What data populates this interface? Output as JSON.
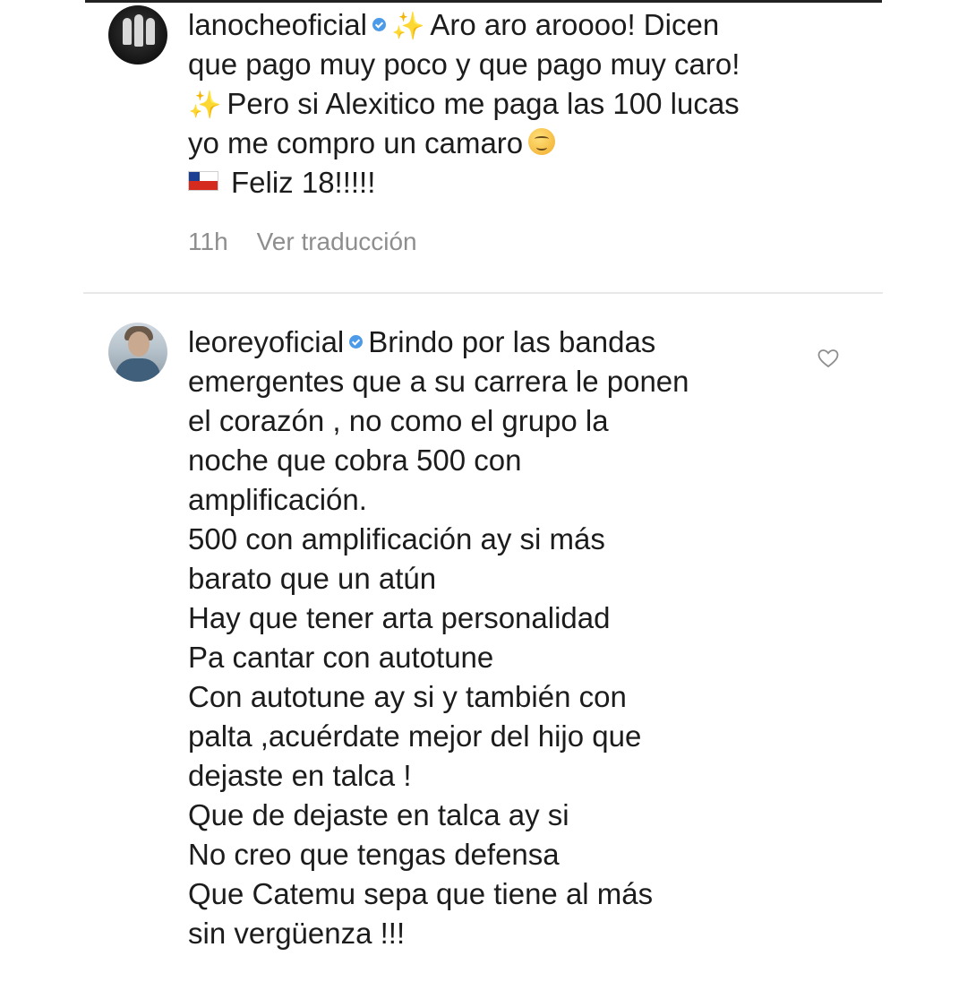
{
  "comments": [
    {
      "username": "lanocheoficial",
      "verified": true,
      "lines": [
        "Aro aro aroooo! Dicen",
        "que pago muy poco y que pago muy caro!",
        "Pero si Alexitico me paga las 100 lucas",
        "yo me compro un camaro",
        "Feliz 18!!!!!"
      ],
      "icons": [
        "sparkles-icon",
        "sparkles-icon",
        "face-emoji-icon",
        "chile-flag-icon"
      ],
      "time": "11h",
      "translate_label": "Ver traducción"
    },
    {
      "username": "leoreyoficial",
      "verified": true,
      "lines": [
        "Brindo por las bandas",
        "emergentes que a su carrera le ponen",
        "el corazón , no como el grupo la",
        "noche que cobra 500 con",
        "amplificación.",
        "500 con amplificación ay si más",
        "barato que un atún",
        "Hay que tener arta personalidad",
        "Pa cantar con autotune",
        "Con autotune ay si y también con",
        "palta ,acuérdate mejor del hijo que",
        "dejaste en talca !",
        "Que de dejaste en talca ay si",
        "No creo que tengas defensa",
        "Que Catemu sepa que tiene al más",
        "sin vergüenza !!!"
      ],
      "like_icon": "heart-icon"
    }
  ],
  "colors": {
    "text": "#1c1c1c",
    "muted": "#8e8e8e",
    "verified": "#4c9be8",
    "divider": "#e8e8e8"
  }
}
